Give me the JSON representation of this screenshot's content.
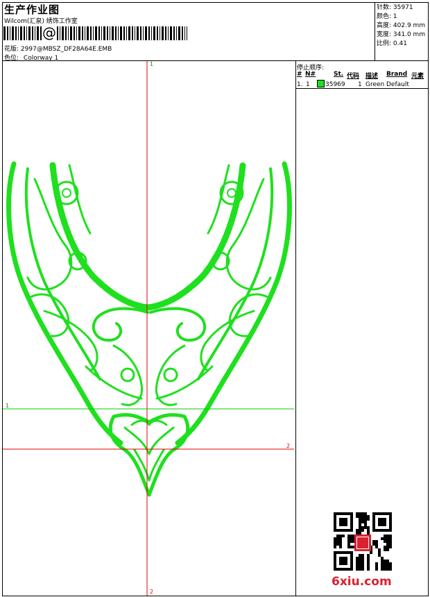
{
  "header": {
    "title": "生产作业图",
    "studio": "Wilcom(汇泉) 绣饰工作室",
    "barcode_symbol": "@",
    "design_file_label": "花版:",
    "design_file": "2997@MBSZ_DF28A64E.EMB",
    "colorway_label": "色位:",
    "colorway": "Colorway 1"
  },
  "stats": [
    {
      "label": "针数:",
      "value": "35971"
    },
    {
      "label": "颜色:",
      "value": "1"
    },
    {
      "label": "高度:",
      "value": "402.9 mm"
    },
    {
      "label": "宽度:",
      "value": "341.0 mm"
    },
    {
      "label": "比例:",
      "value": "0.41"
    }
  ],
  "stop_sequence": {
    "title": "停止顺序:",
    "columns": [
      "#",
      "N#",
      "St.",
      "代码",
      "描述",
      "Brand",
      "元素"
    ],
    "rows": [
      {
        "index": "1.",
        "needle": "1",
        "stitches": "35969",
        "code": "1",
        "description": "Green",
        "brand": "Default",
        "color": "#1ee01e"
      }
    ]
  },
  "axes": {
    "top_label": "1",
    "bottom_label": "2",
    "green_line_label": "1",
    "red_line_label": "2"
  },
  "watermark": {
    "text": "6xiu.com",
    "seal_text": "汇泉 印"
  },
  "colors": {
    "thread": "#1ee01e",
    "axis_red": "#e00000",
    "axis_green": "#00d000",
    "watermark_red": "#d9212f"
  },
  "icons": [
    "barcode-icon",
    "qr-code-icon",
    "seal-icon"
  ]
}
